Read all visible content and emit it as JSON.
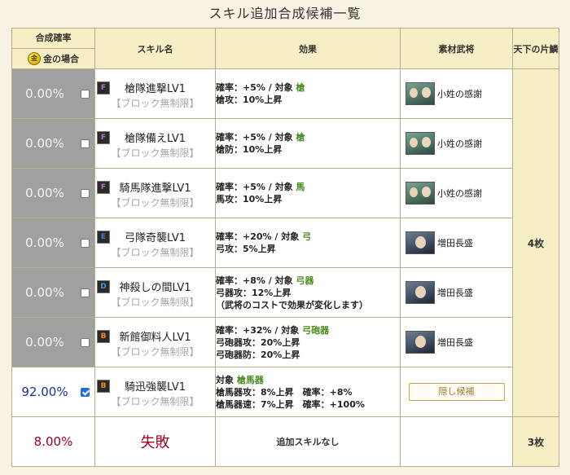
{
  "title": "スキル追加合成候補一覧",
  "headers": {
    "rate": "合成確率",
    "gold": "金の場合",
    "gold_icon": "金",
    "skill": "スキル名",
    "effect": "効果",
    "material": "素材武将",
    "count": "天下の片鱗"
  },
  "rows": [
    {
      "rate": "0.00%",
      "checked": false,
      "rank": "F",
      "skill": "槍隊進撃LV1",
      "limit": "【ブロック無制限】",
      "eff1_a": "確率：+5% / 対象",
      "eff1_t": "槍",
      "eff2": "槍攻：10%上昇",
      "eff3": "",
      "material": "小姓の感謝",
      "face": "a"
    },
    {
      "rate": "0.00%",
      "checked": false,
      "rank": "F",
      "skill": "槍隊備えLV1",
      "limit": "【ブロック無制限】",
      "eff1_a": "確率：+5% / 対象",
      "eff1_t": "槍",
      "eff2": "槍防：10%上昇",
      "eff3": "",
      "material": "小姓の感謝",
      "face": "a"
    },
    {
      "rate": "0.00%",
      "checked": false,
      "rank": "F",
      "skill": "騎馬隊進撃LV1",
      "limit": "【ブロック無制限】",
      "eff1_a": "確率：+5% / 対象",
      "eff1_t": "馬",
      "eff2": "馬攻：10%上昇",
      "eff3": "",
      "material": "小姓の感謝",
      "face": "a"
    },
    {
      "rate": "0.00%",
      "checked": false,
      "rank": "E",
      "skill": "弓隊奇襲LV1",
      "limit": "【ブロック無制限】",
      "eff1_a": "確率：+20% / 対象",
      "eff1_t": "弓",
      "eff2": "弓攻：5%上昇",
      "eff3": "",
      "material": "増田長盛",
      "face": "b"
    },
    {
      "rate": "0.00%",
      "checked": false,
      "rank": "D",
      "skill": "神殺しの間LV1",
      "limit": "【ブロック無制限】",
      "eff1_a": "確率：+8% / 対象",
      "eff1_t": "弓器",
      "eff2": "弓器攻：12%上昇",
      "eff3": "（武将のコストで効果が変化します）",
      "material": "増田長盛",
      "face": "b"
    },
    {
      "rate": "0.00%",
      "checked": false,
      "rank": "B",
      "skill": "新館御料人LV1",
      "limit": "【ブロック無制限】",
      "eff1_a": "確率：+32% / 対象",
      "eff1_t": "弓砲器",
      "eff2": "弓砲器攻：20%上昇",
      "eff3": "弓砲器防：20%上昇",
      "material": "増田長盛",
      "face": "b"
    },
    {
      "rate": "92.00%",
      "checked": true,
      "rank": "B",
      "skill": "騎迅強襲LV1",
      "limit": "【ブロック無制限】",
      "eff1_a": "対象",
      "eff1_t": "槍馬器",
      "eff2": "槍馬器攻：8%上昇　確率：+8%",
      "eff3": "槍馬器速：7%上昇　確率：+100%",
      "material": "",
      "face": "",
      "button": "隠し候補"
    }
  ],
  "count_main": "4枚",
  "fail": {
    "rate": "8.00%",
    "label": "失敗",
    "effect": "追加スキルなし",
    "count": "3枚"
  }
}
